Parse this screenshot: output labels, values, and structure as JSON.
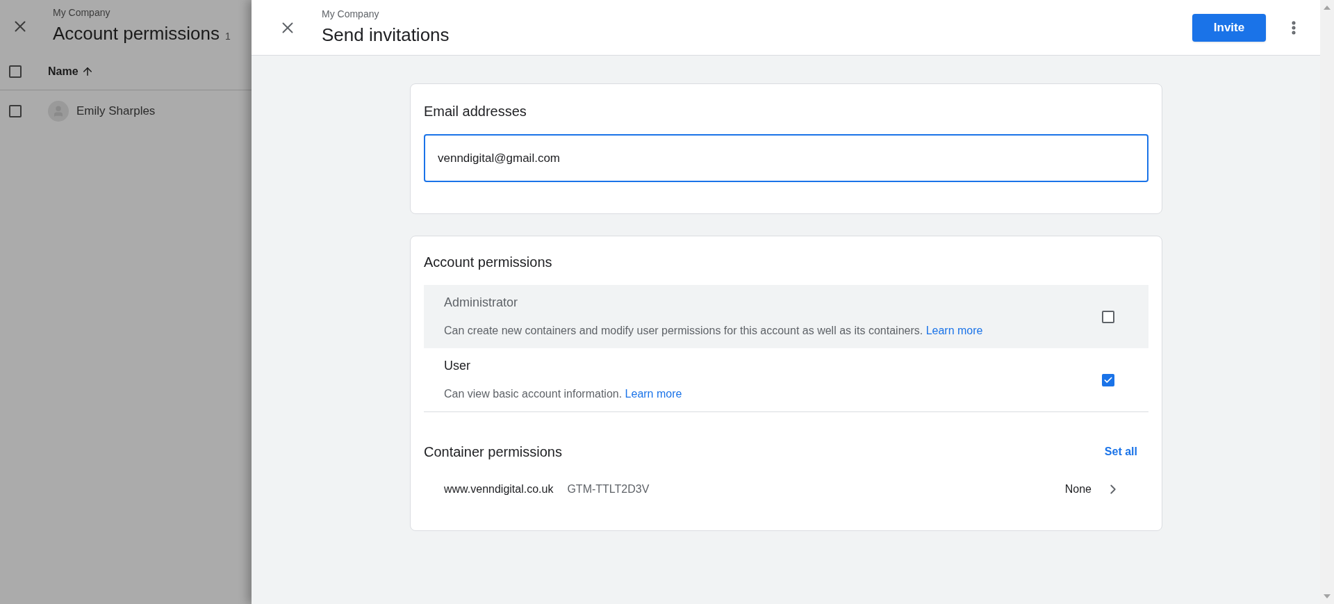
{
  "background_page": {
    "breadcrumb": "My Company",
    "title": "Account permissions",
    "count": "1",
    "columns": [
      {
        "label": "Name"
      }
    ],
    "rows": [
      {
        "name": "Emily Sharples",
        "checked": false
      }
    ],
    "select_all_checked": false
  },
  "panel": {
    "breadcrumb": "My Company",
    "title": "Send invitations",
    "primary_button": "Invite"
  },
  "email_card": {
    "title": "Email addresses",
    "value": "venndigital@gmail.com"
  },
  "account_permissions": {
    "title": "Account permissions",
    "options": [
      {
        "label": "Administrator",
        "description": "Can create new containers and modify user permissions for this account as well as its containers.",
        "link": "Learn more",
        "checked": false,
        "hovered": true
      },
      {
        "label": "User",
        "description": "Can view basic account information.",
        "link": "Learn more",
        "checked": true,
        "hovered": false
      }
    ]
  },
  "container_permissions": {
    "title": "Container permissions",
    "action": "Set all",
    "containers": [
      {
        "name": "www.venndigital.co.uk",
        "id": "GTM-TTLT2D3V",
        "permission": "None"
      }
    ]
  }
}
